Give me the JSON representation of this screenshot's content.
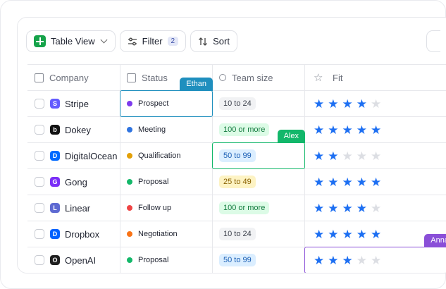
{
  "toolbar": {
    "view_label": "Table View",
    "filter_label": "Filter",
    "filter_count": "2",
    "sort_label": "Sort"
  },
  "headers": [
    "Company",
    "Status",
    "Team size",
    "Fit"
  ],
  "rows": [
    {
      "company": "Stripe",
      "logo": "S",
      "logo_color": "#635bff",
      "status": "Prospect",
      "status_color": "#7c3aed",
      "team_size": "10 to 24",
      "team_bg": "#f1f2f4",
      "team_fg": "#3a3f4a",
      "fit": 4
    },
    {
      "company": "Dokey",
      "logo": "b",
      "logo_color": "#111111",
      "status": "Meeting",
      "status_color": "#2f74e0",
      "team_size": "100 or more",
      "team_bg": "#dcfbe6",
      "team_fg": "#117a3d",
      "fit": 5
    },
    {
      "company": "DigitalOcean",
      "logo": "D",
      "logo_color": "#0069ff",
      "status": "Qualification",
      "status_color": "#e3a008",
      "team_size": "50 to 99",
      "team_bg": "#dbeeff",
      "team_fg": "#1b5fb5",
      "fit": 2
    },
    {
      "company": "Gong",
      "logo": "G",
      "logo_color": "#7b2ff7",
      "status": "Proposal",
      "status_color": "#14b86a",
      "team_size": "25 to 49",
      "team_bg": "#fdf3c4",
      "team_fg": "#8a6100",
      "fit": 5
    },
    {
      "company": "Linear",
      "logo": "L",
      "logo_color": "#5e6ad2",
      "status": "Follow up",
      "status_color": "#ef4444",
      "team_size": "100 or more",
      "team_bg": "#dcfbe6",
      "team_fg": "#117a3d",
      "fit": 4
    },
    {
      "company": "Dropbox",
      "logo": "D",
      "logo_color": "#0061fe",
      "status": "Negotiation",
      "status_color": "#f97316",
      "team_size": "10 to 24",
      "team_bg": "#f1f2f4",
      "team_fg": "#3a3f4a",
      "fit": 5
    },
    {
      "company": "OpenAI",
      "logo": "O",
      "logo_color": "#1f1f1f",
      "status": "Proposal",
      "status_color": "#14b86a",
      "team_size": "50 to 99",
      "team_bg": "#dbeeff",
      "team_fg": "#1b5fb5",
      "fit": 3
    }
  ],
  "collaborators": [
    {
      "name": "Ethan",
      "color": "#1f8fbe",
      "row": 0,
      "col": "status"
    },
    {
      "name": "Alex",
      "color": "#12b76a",
      "row": 2,
      "col": "team_size"
    },
    {
      "name": "Anna",
      "color": "#8a4fd8",
      "row": 6,
      "col": "fit"
    }
  ],
  "max_stars": 5
}
